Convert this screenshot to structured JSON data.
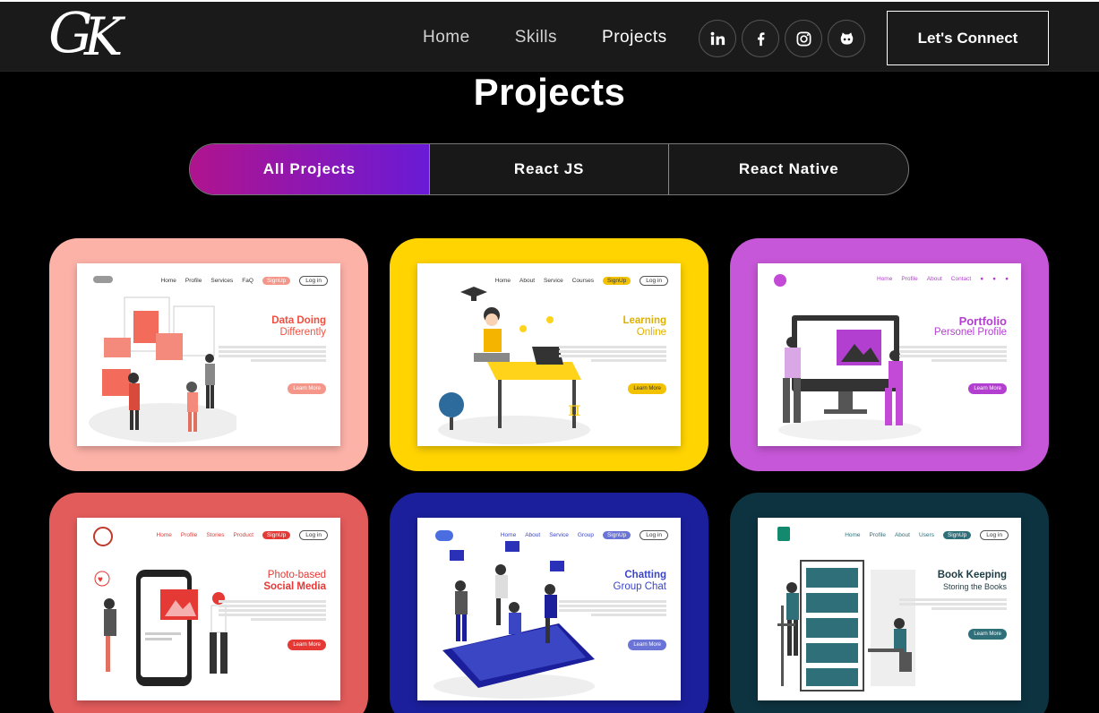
{
  "logo": {
    "g": "G",
    "k": "K"
  },
  "nav": {
    "links": [
      "Home",
      "Skills",
      "Projects"
    ],
    "socials": [
      "linkedin-icon",
      "facebook-icon",
      "instagram-icon",
      "github-icon"
    ],
    "cta": "Let's Connect"
  },
  "projects": {
    "title": "Projects",
    "tabs": [
      "All Projects",
      "React JS",
      "React Native"
    ],
    "cards": [
      {
        "bg": "#fdb2a8",
        "accent": "#f04f3f",
        "nav": [
          "Home",
          "Profile",
          "Services",
          "FaQ"
        ],
        "signup": "SignUp",
        "login": "Log in",
        "h1": "Data Doing",
        "h2": "Differently",
        "button": "Learn More"
      },
      {
        "bg": "#ffd400",
        "accent": "#f2c200",
        "nav": [
          "Home",
          "About",
          "Service",
          "Courses"
        ],
        "signup": "SignUp",
        "login": "Log in",
        "h1": "Learning",
        "h2": "Online",
        "button": "Learn More"
      },
      {
        "bg": "#c657d8",
        "accent": "#b33fd0",
        "nav": [
          "Home",
          "Profile",
          "About",
          "Contact"
        ],
        "signup": "",
        "login": "",
        "h1": "Portfolio",
        "h2": "Personel Profile",
        "button": "Learn More"
      },
      {
        "bg": "#e35c5c",
        "accent": "#e53935",
        "nav": [
          "Home",
          "Profile",
          "Stories",
          "Product"
        ],
        "signup": "SignUp",
        "login": "Log in",
        "h1": "Photo-based",
        "h2": "Social Media",
        "button": "Learn More"
      },
      {
        "bg": "#1b1f9b",
        "accent": "#6a73d6",
        "nav": [
          "Home",
          "About",
          "Service",
          "Group"
        ],
        "signup": "SignUp",
        "login": "Log in",
        "h1": "Chatting",
        "h2": "Group Chat",
        "button": "Learn More"
      },
      {
        "bg": "#0d3340",
        "accent": "#2f6f7a",
        "nav": [
          "Home",
          "Profile",
          "About",
          "Users"
        ],
        "signup": "SignUp",
        "login": "Log in",
        "h1": "Book Keeping",
        "h2": "Storing the Books",
        "button": "Learn More"
      }
    ]
  }
}
